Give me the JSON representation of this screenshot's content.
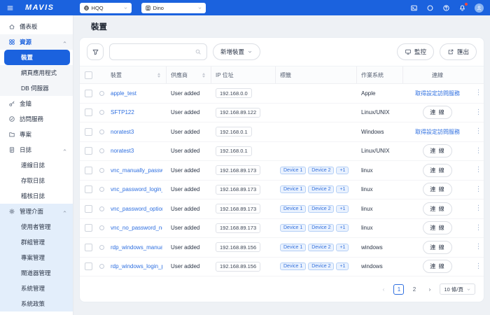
{
  "colors": {
    "brand_blue": "#1b62de",
    "link_blue": "#2e6fe0",
    "tag_bg": "#eaf2fe",
    "tag_border": "#b5d0f6",
    "notification_badge": "#f5493d"
  },
  "topbar": {
    "brand": "MAVIS",
    "menu_icon": "hamburger-icon",
    "org_select": {
      "icon": "globe-icon",
      "value": "HQQ"
    },
    "tenant_select": {
      "icon": "building-icon",
      "value": "Dino"
    },
    "icons": [
      {
        "name": "remote-session-icon"
      },
      {
        "name": "circle-icon"
      },
      {
        "name": "help-icon"
      },
      {
        "name": "bell-icon",
        "badge": true
      },
      {
        "name": "user-avatar",
        "avatar": true
      }
    ]
  },
  "sidebar": {
    "items": [
      {
        "label": "儀表板",
        "icon": "home",
        "type": "item"
      },
      {
        "label": "資源",
        "icon": "grid",
        "type": "group",
        "expanded": true,
        "active": true,
        "tint": "gray"
      },
      {
        "label": "裝置",
        "type": "sub",
        "selected": true,
        "tint": "gray"
      },
      {
        "label": "網頁應用程式",
        "type": "sub",
        "tint": "gray"
      },
      {
        "label": "DB 伺服器",
        "type": "sub",
        "tint": "gray"
      },
      {
        "label": "金鑰",
        "icon": "key",
        "type": "item"
      },
      {
        "label": "訪問服務",
        "icon": "badge",
        "type": "item"
      },
      {
        "label": "專案",
        "icon": "folder",
        "type": "item"
      },
      {
        "label": "日誌",
        "icon": "doc",
        "type": "group",
        "expanded": true
      },
      {
        "label": "連線日誌",
        "type": "sub"
      },
      {
        "label": "存取日誌",
        "type": "sub"
      },
      {
        "label": "稽核日誌",
        "type": "sub"
      },
      {
        "label": "管理介面",
        "icon": "gear",
        "type": "group",
        "expanded": true,
        "tint": "blue"
      },
      {
        "label": "使用者管理",
        "type": "sub",
        "tint": "blue"
      },
      {
        "label": "群組管理",
        "type": "sub",
        "tint": "blue"
      },
      {
        "label": "專案管理",
        "type": "sub",
        "tint": "blue"
      },
      {
        "label": "閘道器管理",
        "type": "sub",
        "tint": "blue"
      },
      {
        "label": "系統管理",
        "type": "sub",
        "tint": "blue"
      },
      {
        "label": "系統政策",
        "type": "sub",
        "tint": "blue"
      }
    ]
  },
  "page": {
    "title": "裝置"
  },
  "toolbar": {
    "filter_icon": "funnel-icon",
    "search_placeholder": "",
    "search_icon": "search-icon",
    "add_button": "新增裝置",
    "monitor_button": "監控",
    "monitor_icon": "monitor-icon",
    "export_button": "匯出",
    "export_icon": "export-icon"
  },
  "table": {
    "columns": {
      "device": "裝置",
      "vendor": "供應商",
      "ip": "IP 位址",
      "tags": "標籤",
      "os": "作業系統",
      "connect": "連線"
    },
    "rows": [
      {
        "name": "apple_test",
        "vendor": "User added",
        "ip": "192.168.0.0",
        "tags": [],
        "os": "Apple",
        "action": "取得設定訪問服務",
        "action_type": "link"
      },
      {
        "name": "SFTP122",
        "vendor": "User added",
        "ip": "192.168.89.122",
        "tags": [],
        "os": "Linux/UNIX",
        "action": "連 線",
        "action_type": "button"
      },
      {
        "name": "noratest3",
        "vendor": "User added",
        "ip": "192.168.0.1",
        "tags": [],
        "os": "Windows",
        "action": "取得設定訪問服務",
        "action_type": "link"
      },
      {
        "name": "noratest3",
        "vendor": "User added",
        "ip": "192.168.0.1",
        "tags": [],
        "os": "Linux/UNIX",
        "action": "連 線",
        "action_type": "button"
      },
      {
        "name": "vnc_manually_passwo...",
        "vendor": "User added",
        "ip": "192.168.89.173",
        "tags": [
          "Device 1",
          "Device 2",
          "+1"
        ],
        "os": "linux",
        "action": "連 線",
        "action_type": "button"
      },
      {
        "name": "vnc_password_login_...",
        "vendor": "User added",
        "ip": "192.168.89.173",
        "tags": [
          "Device 1",
          "Device 2",
          "+1"
        ],
        "os": "linux",
        "action": "連 線",
        "action_type": "button"
      },
      {
        "name": "vnc_password_option...",
        "vendor": "User added",
        "ip": "192.168.89.173",
        "tags": [
          "Device 1",
          "Device 2",
          "+1"
        ],
        "os": "linux",
        "action": "連 線",
        "action_type": "button"
      },
      {
        "name": "vnc_no_password_no...",
        "vendor": "User added",
        "ip": "192.168.89.173",
        "tags": [
          "Device 1",
          "Device 2",
          "+1"
        ],
        "os": "linux",
        "action": "連 線",
        "action_type": "button"
      },
      {
        "name": "rdp_windows_manuall...",
        "vendor": "User added",
        "ip": "192.168.89.156",
        "tags": [
          "Device 1",
          "Device 2",
          "+1"
        ],
        "os": "windows",
        "action": "連 線",
        "action_type": "button"
      },
      {
        "name": "rdp_windows_login_pa...",
        "vendor": "User added",
        "ip": "192.168.89.156",
        "tags": [
          "Device 1",
          "Device 2",
          "+1"
        ],
        "os": "windows",
        "action": "連 線",
        "action_type": "button"
      }
    ]
  },
  "pagination": {
    "prev_icon": "chevron-left-icon",
    "next_icon": "chevron-right-icon",
    "pages": [
      "1",
      "2"
    ],
    "active_page": "1",
    "page_size_label": "10 條/頁"
  }
}
